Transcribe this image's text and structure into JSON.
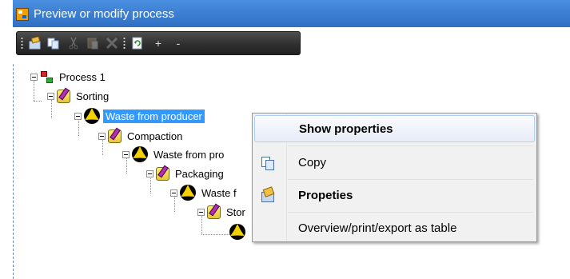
{
  "window": {
    "title": "Preview or modify process"
  },
  "toolbar": {
    "buttons": [
      {
        "icon": "properties-icon",
        "enabled": true
      },
      {
        "icon": "copy-icon",
        "enabled": true
      },
      {
        "icon": "cut-icon",
        "enabled": false
      },
      {
        "icon": "paste-icon",
        "enabled": false
      },
      {
        "icon": "delete-icon",
        "enabled": false
      },
      {
        "icon": "refresh-icon",
        "enabled": true
      },
      {
        "icon": "expand-all-icon",
        "label": "+",
        "enabled": true
      },
      {
        "icon": "collapse-all-icon",
        "label": "-",
        "enabled": true
      }
    ]
  },
  "tree": {
    "nodes": [
      {
        "label": "Process 1",
        "icon": "process-icon"
      },
      {
        "label": "Sorting",
        "icon": "step-icon"
      },
      {
        "label": "Waste from producer",
        "icon": "radioactive-icon",
        "selected": true
      },
      {
        "label": "Compaction",
        "icon": "step-icon"
      },
      {
        "label": "Waste from pro",
        "icon": "radioactive-icon"
      },
      {
        "label": "Packaging",
        "icon": "step-icon"
      },
      {
        "label": "Waste f",
        "icon": "radioactive-icon"
      },
      {
        "label": "Stor",
        "icon": "step-icon"
      },
      {
        "label": "",
        "icon": "radioactive-icon"
      }
    ]
  },
  "context_menu": {
    "items": [
      {
        "label": "Show properties",
        "bold": true,
        "highlighted": true
      },
      {
        "label": "Copy",
        "icon": "copy-icon"
      },
      {
        "label": "Propeties",
        "bold": true,
        "icon": "properties-icon"
      },
      {
        "label": "Overview/print/export as table"
      }
    ]
  }
}
